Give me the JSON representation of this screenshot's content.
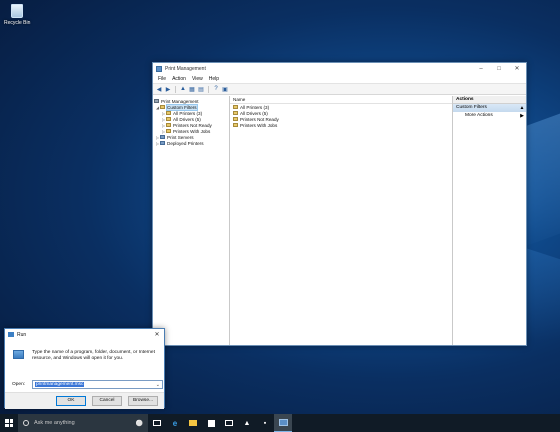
{
  "desktop": {
    "recycle_bin_label": "Recycle Bin"
  },
  "pm_window": {
    "title": "Print Management",
    "menu": [
      "File",
      "Action",
      "View",
      "Help"
    ],
    "tree": {
      "root": "Print Management",
      "custom_filters": "Custom Filters",
      "filters": [
        "All Printers (3)",
        "All Drivers (5)",
        "Printers Not Ready",
        "Printers With Jobs"
      ],
      "print_servers": "Print Servers",
      "deployed_printers": "Deployed Printers"
    },
    "list": {
      "column_name": "Name",
      "items": [
        "All Printers (3)",
        "All Drivers (5)",
        "Printers Not Ready",
        "Printers With Jobs"
      ]
    },
    "actions": {
      "header": "Actions",
      "section": "Custom Filters",
      "more_actions": "More Actions"
    }
  },
  "run_dialog": {
    "title": "Run",
    "description": "Type the name of a program, folder, document, or Internet resource, and Windows will open it for you.",
    "open_label": "Open:",
    "open_value": "printmanagement.msc",
    "ok_label": "OK",
    "cancel_label": "Cancel",
    "browse_label": "Browse..."
  },
  "taskbar": {
    "search_placeholder": "Ask me anything"
  },
  "colors": {
    "accent": "#0078d7",
    "taskbar": "#101b26",
    "selection": "#3875d7"
  }
}
